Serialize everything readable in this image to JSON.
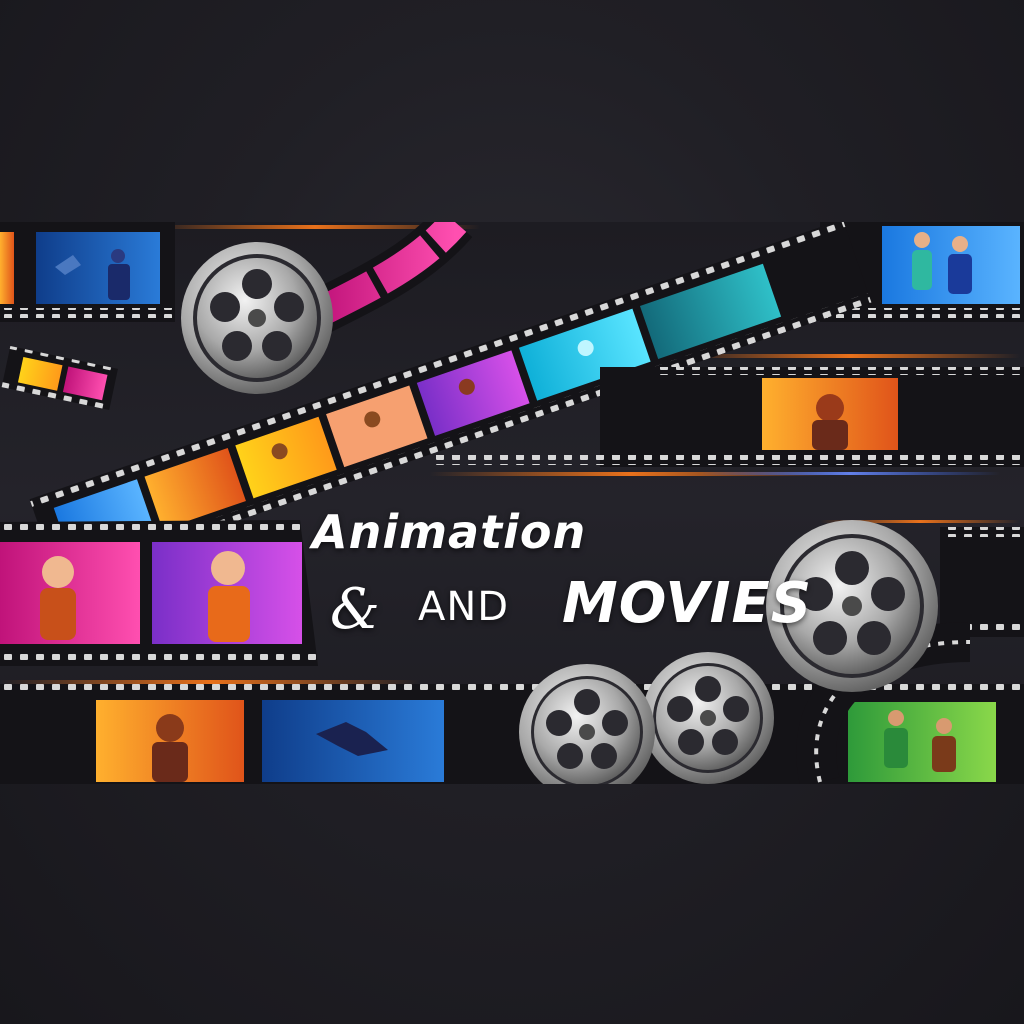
{
  "title": {
    "line1": "Animation",
    "ampersand": "&",
    "and_word": "AND",
    "movies_word": "MOVIES"
  },
  "colors": {
    "background": "#1b1a20",
    "banner": "#222127",
    "film": "#141317",
    "sprocket": "#d8d8d8",
    "text": "#ffffff",
    "glow_orange": "#ff7a1a",
    "glow_blue": "#3a6bff"
  },
  "icons": [
    "film-reel-icon",
    "film-strip-icon"
  ]
}
